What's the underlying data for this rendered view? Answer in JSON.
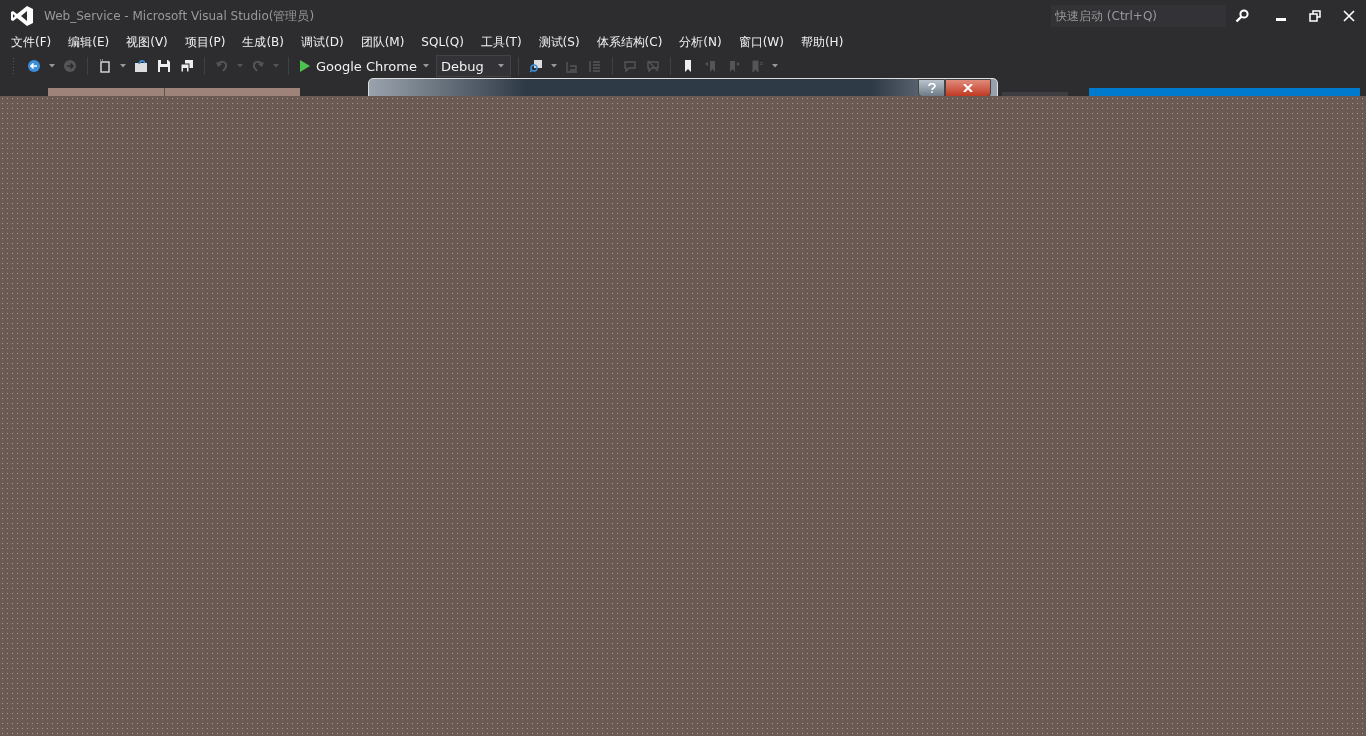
{
  "window": {
    "title": "Web_Service - Microsoft Visual Studio(管理员)"
  },
  "quick_launch": {
    "placeholder": "快速启动 (Ctrl+Q)"
  },
  "menu": [
    "文件(F)",
    "编辑(E)",
    "视图(V)",
    "项目(P)",
    "生成(B)",
    "调试(D)",
    "团队(M)",
    "SQL(Q)",
    "工具(T)",
    "测试(S)",
    "体系结构(C)",
    "分析(N)",
    "窗口(W)",
    "帮助(H)"
  ],
  "toolbar": {
    "target": "Google Chrome",
    "configuration": "Debug"
  },
  "dialog": {
    "kind": "window"
  }
}
